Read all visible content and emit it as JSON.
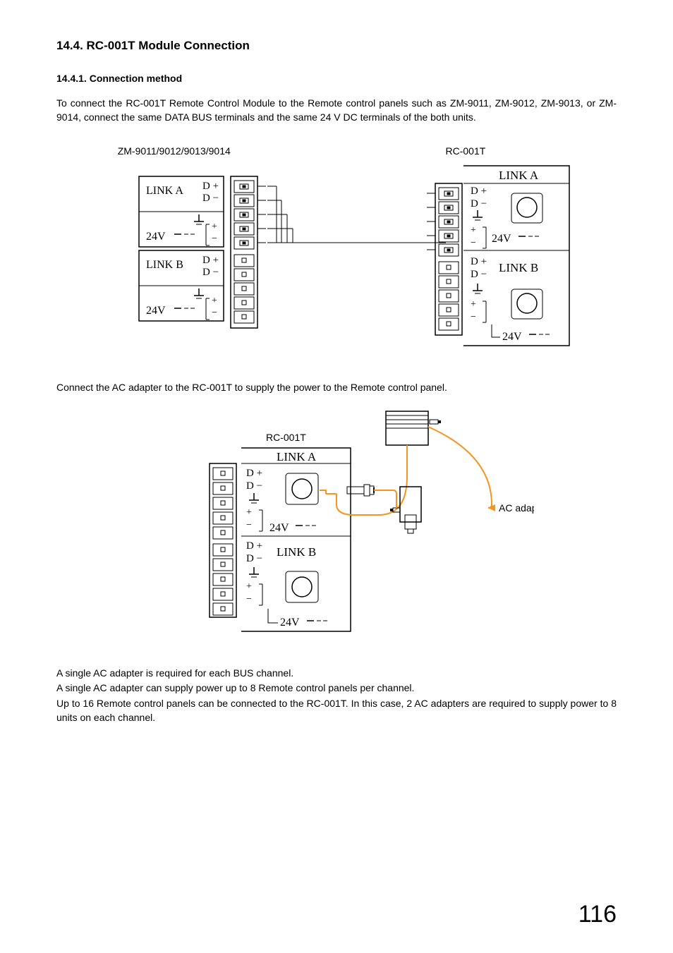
{
  "section": {
    "title": "14.4. RC-001T Module Connection",
    "subtitle": "14.4.1. Connection method",
    "para1": "To connect the RC-001T Remote Control Module to the Remote control panels such as ZM-9011, ZM-9012, ZM-9013, or ZM-9014, connect the same DATA BUS terminals and the same 24 V DC terminals of the both units.",
    "para2": "Connect the AC adapter to the RC-001T to supply the power to the Remote control panel.",
    "para3a": "A single AC adapter is required for each BUS channel.",
    "para3b": "A single AC adapter can supply power up to 8 Remote control panels per channel.",
    "para3c": "Up to 16 Remote control panels can be connected to the RC-001T. In this case, 2 AC adapters are required to supply power to 8 units on each channel."
  },
  "fig1": {
    "left_label": "ZM-9011/9012/9013/9014",
    "right_label": "RC-001T",
    "link_a": "LINK A",
    "link_b": "LINK B",
    "dplus": "D",
    "dminus": "D",
    "v24": "24V"
  },
  "fig2": {
    "rc_label": "RC-001T",
    "link_a": "LINK A",
    "link_b": "LINK B",
    "v24": "24V",
    "dplus": "D",
    "dminus": "D",
    "ac": "AC adapter"
  },
  "page": "116"
}
